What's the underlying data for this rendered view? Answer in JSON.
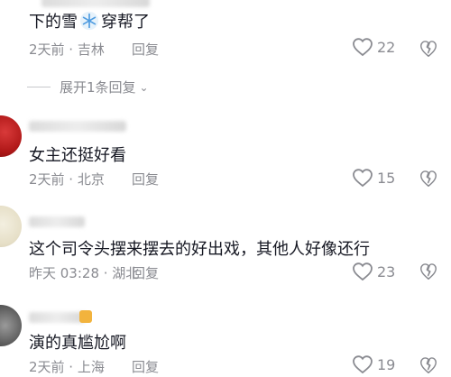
{
  "comments": [
    {
      "text": "下的雪",
      "text_after": "穿帮了",
      "meta": "2天前 · 吉林",
      "reply": "回复",
      "likes": "22"
    },
    {
      "text": "女主还挺好看",
      "meta": "2天前 · 北京",
      "reply": "回复",
      "likes": "15"
    },
    {
      "text": "这个司令头摆来摆去的好出戏，其他人好像还行",
      "meta": "昨天 03:28 · 湖北",
      "reply": "回复",
      "likes": "23"
    },
    {
      "text": "演的真尴尬啊",
      "meta": "2天前 · 上海",
      "reply": "回复",
      "likes": "19"
    }
  ],
  "expand_label": "展开1条回复",
  "icons": {
    "like": "heart-outline-icon",
    "dislike": "dislike-icon",
    "snow": "snowflake-icon",
    "chevron": "chevron-down-icon"
  },
  "colors": {
    "text": "#161823",
    "secondary": "#8a8b91",
    "background": "#ffffff"
  }
}
